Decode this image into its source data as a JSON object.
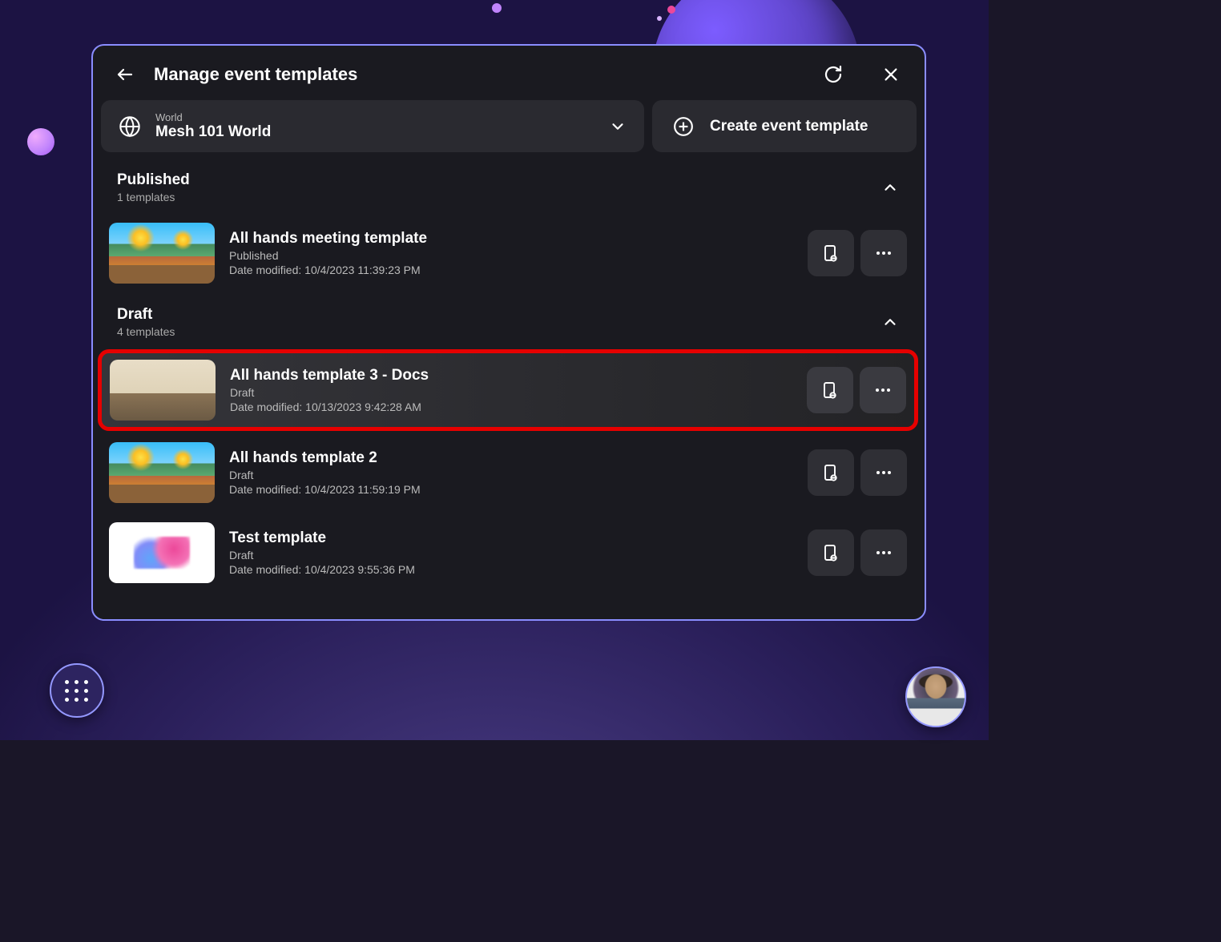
{
  "header": {
    "title": "Manage event templates"
  },
  "world_selector": {
    "label": "World",
    "value": "Mesh 101 World"
  },
  "create_button": {
    "label": "Create event template"
  },
  "sections": [
    {
      "title": "Published",
      "subtitle": "1 templates",
      "rows": [
        {
          "title": "All hands meeting template",
          "status": "Published",
          "date": "Date modified: 10/4/2023 11:39:23 PM",
          "thumb": "scene1",
          "highlighted": false
        }
      ]
    },
    {
      "title": "Draft",
      "subtitle": "4 templates",
      "rows": [
        {
          "title": "All hands template 3 - Docs",
          "status": "Draft",
          "date": "Date modified: 10/13/2023 9:42:28 AM",
          "thumb": "scene2",
          "highlighted": true
        },
        {
          "title": "All hands template 2",
          "status": "Draft",
          "date": "Date modified: 10/4/2023 11:59:19 PM",
          "thumb": "scene1",
          "highlighted": false
        },
        {
          "title": "Test template",
          "status": "Draft",
          "date": "Date modified: 10/4/2023 9:55:36 PM",
          "thumb": "scene3",
          "highlighted": false
        }
      ]
    }
  ]
}
